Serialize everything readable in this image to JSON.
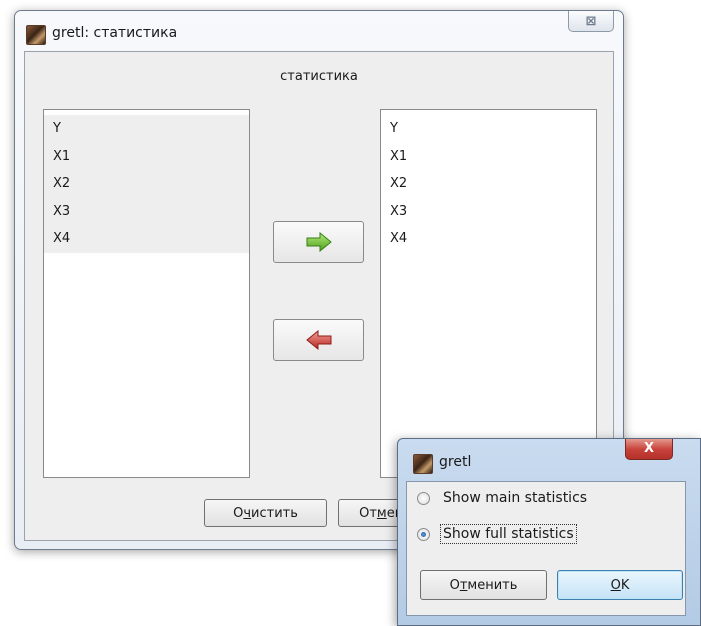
{
  "main_window": {
    "title": "gretl: статистика",
    "close_glyph": "⊠",
    "section_label": "статистика",
    "left_list": [
      "Y",
      "X1",
      "X2",
      "X3",
      "X4"
    ],
    "right_list": [
      "Y",
      "X1",
      "X2",
      "X3",
      "X4"
    ],
    "add_icon": "green-right-arrow",
    "remove_icon": "red-left-arrow",
    "clear_button": {
      "pre": "О",
      "mnemonic": "ч",
      "post": "истить"
    },
    "cancel_button": {
      "pre": "От",
      "mnemonic": "м",
      "post": "енить"
    }
  },
  "dialog": {
    "title": "gretl",
    "close_glyph": "X",
    "options": [
      {
        "label": "Show main statistics",
        "checked": false
      },
      {
        "label": "Show full statistics",
        "checked": true
      }
    ],
    "cancel_button": {
      "pre": "О",
      "mnemonic": "т",
      "post": "менить"
    },
    "ok_button": {
      "mnemonic": "O",
      "post": "K"
    }
  },
  "colors": {
    "arrow_green": "#5fb526",
    "arrow_red": "#c9302c",
    "dialog_close_red": "#c7423a"
  }
}
